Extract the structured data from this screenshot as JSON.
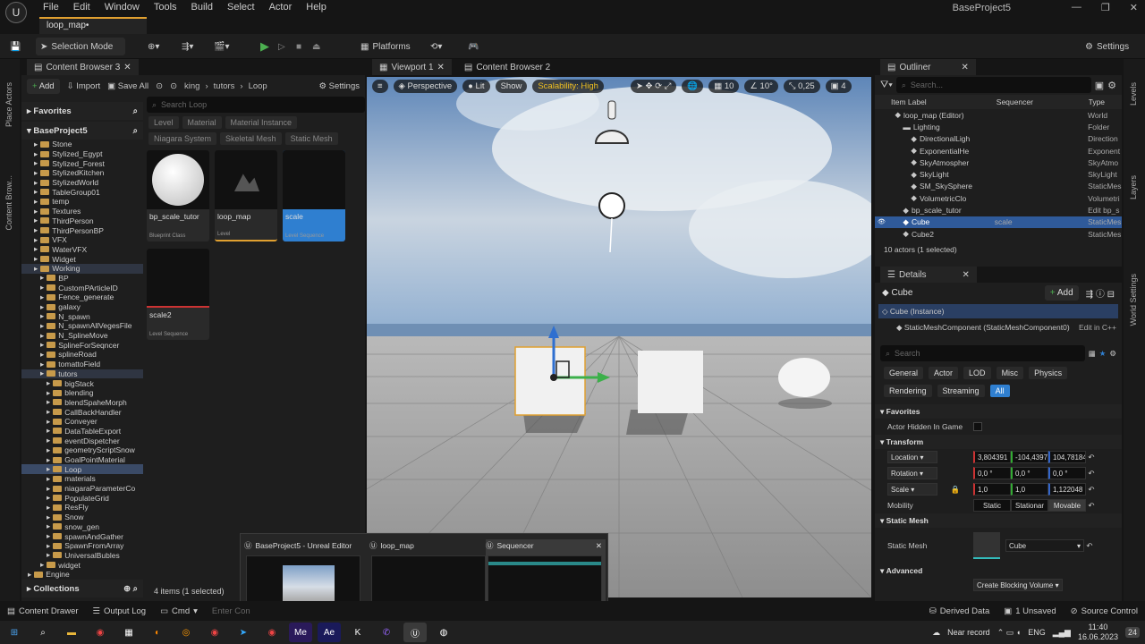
{
  "menu": {
    "items": [
      "File",
      "Edit",
      "Window",
      "Tools",
      "Build",
      "Select",
      "Actor",
      "Help"
    ],
    "project": "BaseProject5",
    "map_tab": "loop_map•"
  },
  "toolbar": {
    "selection_mode": "Selection Mode",
    "platforms": "Platforms",
    "settings": "Settings"
  },
  "left_strip": {
    "place_actors": "Place Actors",
    "content_browser": "Content Brow..."
  },
  "cb": {
    "tab": "Content Browser 3",
    "add": "Add",
    "import": "Import",
    "save_all": "Save All",
    "crumbs": [
      "king",
      "tutors",
      "Loop"
    ],
    "settings": "Settings",
    "favorites": "Favorites",
    "project": "BaseProject5",
    "collections": "Collections",
    "search_placeholder": "Search Loop",
    "filters": [
      "Level",
      "Material",
      "Material Instance",
      "Niagara System",
      "Skeletal Mesh",
      "Static Mesh"
    ],
    "tree": [
      {
        "label": "Stone",
        "indent": 2
      },
      {
        "label": "Stylized_Egypt",
        "indent": 2
      },
      {
        "label": "Stylized_Forest",
        "indent": 2
      },
      {
        "label": "StylizedKitchen",
        "indent": 2
      },
      {
        "label": "StylizedWorld",
        "indent": 2
      },
      {
        "label": "TableGroup01",
        "indent": 2
      },
      {
        "label": "temp",
        "indent": 2
      },
      {
        "label": "Textures",
        "indent": 2
      },
      {
        "label": "ThirdPerson",
        "indent": 2
      },
      {
        "label": "ThirdPersonBP",
        "indent": 2
      },
      {
        "label": "VFX",
        "indent": 2
      },
      {
        "label": "WaterVFX",
        "indent": 2
      },
      {
        "label": "Widget",
        "indent": 2
      },
      {
        "label": "Working",
        "indent": 2,
        "selected": "dim"
      },
      {
        "label": "BP",
        "indent": 3
      },
      {
        "label": "CustomPArticleID",
        "indent": 3
      },
      {
        "label": "Fence_generate",
        "indent": 3
      },
      {
        "label": "galaxy",
        "indent": 3
      },
      {
        "label": "N_spawn",
        "indent": 3
      },
      {
        "label": "N_spawnAllVegesFile",
        "indent": 3
      },
      {
        "label": "N_SplineMove",
        "indent": 3
      },
      {
        "label": "SplineForSeqncer",
        "indent": 3
      },
      {
        "label": "splineRoad",
        "indent": 3
      },
      {
        "label": "tomattoField",
        "indent": 3
      },
      {
        "label": "tutors",
        "indent": 3,
        "selected": "dim"
      },
      {
        "label": "bigStack",
        "indent": 4
      },
      {
        "label": "blending",
        "indent": 4
      },
      {
        "label": "blendSpaheMorph",
        "indent": 4
      },
      {
        "label": "CallBackHandler",
        "indent": 4
      },
      {
        "label": "Conveyer",
        "indent": 4
      },
      {
        "label": "DataTableExport",
        "indent": 4
      },
      {
        "label": "eventDispetcher",
        "indent": 4
      },
      {
        "label": "geometryScriptSnow",
        "indent": 4
      },
      {
        "label": "GoalPointMaterial",
        "indent": 4
      },
      {
        "label": "Loop",
        "indent": 4,
        "selected": "yes"
      },
      {
        "label": "materials",
        "indent": 4
      },
      {
        "label": "niagaraParameterCo",
        "indent": 4
      },
      {
        "label": "PopulateGrid",
        "indent": 4
      },
      {
        "label": "ResFly",
        "indent": 4
      },
      {
        "label": "Snow",
        "indent": 4
      },
      {
        "label": "snow_gen",
        "indent": 4
      },
      {
        "label": "spawnAndGather",
        "indent": 4
      },
      {
        "label": "SpawnFromArray",
        "indent": 4
      },
      {
        "label": "UniversalBubles",
        "indent": 4
      },
      {
        "label": "widget",
        "indent": 3
      },
      {
        "label": "Engine",
        "indent": 1
      }
    ],
    "assets": [
      {
        "name": "bp_scale_tutor",
        "type": "Blueprint Class"
      },
      {
        "name": "loop_map",
        "type": "Level"
      },
      {
        "name": "scale",
        "type": "Level Sequence"
      },
      {
        "name": "scale2",
        "type": "Level Sequence"
      }
    ],
    "footer": "4 items (1 selected)"
  },
  "viewport": {
    "tab1": "Viewport 1",
    "tab2": "Content Browser 2",
    "perspective": "Perspective",
    "lit": "Lit",
    "show": "Show",
    "scalability": "Scalability: High",
    "grid": "10",
    "angle": "10°",
    "scale": "0,25",
    "speed": "4"
  },
  "outliner": {
    "tab": "Outliner",
    "search": "Search...",
    "col_label": "Item Label",
    "col_seq": "Sequencer",
    "col_type": "Type",
    "rows": [
      {
        "label": "loop_map (Editor)",
        "seq": "",
        "type": "World",
        "indent": 1
      },
      {
        "label": "Lighting",
        "seq": "",
        "type": "Folder",
        "indent": 2
      },
      {
        "label": "DirectionalLigh",
        "seq": "",
        "type": "Direction",
        "indent": 3
      },
      {
        "label": "ExponentialHe",
        "seq": "",
        "type": "Exponent",
        "indent": 3
      },
      {
        "label": "SkyAtmospher",
        "seq": "",
        "type": "SkyAtmo",
        "indent": 3
      },
      {
        "label": "SkyLight",
        "seq": "",
        "type": "SkyLight",
        "indent": 3
      },
      {
        "label": "SM_SkySphere",
        "seq": "",
        "type": "StaticMes",
        "indent": 3
      },
      {
        "label": "VolumetricClo",
        "seq": "",
        "type": "Volumetri",
        "indent": 3
      },
      {
        "label": "bp_scale_tutor",
        "seq": "",
        "type": "Edit bp_s",
        "indent": 2
      },
      {
        "label": "Cube",
        "seq": "scale",
        "type": "StaticMes",
        "indent": 2,
        "selected": true
      },
      {
        "label": "Cube2",
        "seq": "",
        "type": "StaticMes",
        "indent": 2
      }
    ],
    "footer": "10 actors (1 selected)"
  },
  "details": {
    "tab": "Details",
    "name": "Cube",
    "add": "Add",
    "instance": "Cube (Instance)",
    "component": "StaticMeshComponent (StaticMeshComponent0)",
    "edit_cpp": "Edit in C++",
    "search": "Search",
    "filters": [
      "General",
      "Actor",
      "LOD",
      "Misc",
      "Physics",
      "Rendering",
      "Streaming",
      "All"
    ],
    "favorites": "Favorites",
    "actor_hidden": "Actor Hidden In Game",
    "transform": "Transform",
    "location": {
      "label": "Location",
      "x": "3,804391",
      "y": "-104,4397",
      "z": "104,78184"
    },
    "rotation": {
      "label": "Rotation",
      "x": "0,0 °",
      "y": "0,0 °",
      "z": "0,0 °"
    },
    "scale": {
      "label": "Scale",
      "x": "1,0",
      "y": "1,0",
      "z": "1,122048"
    },
    "mobility": {
      "label": "Mobility",
      "options": [
        "Static",
        "Stationar",
        "Movable"
      ]
    },
    "static_mesh_sec": "Static Mesh",
    "static_mesh_label": "Static Mesh",
    "mesh_value": "Cube",
    "advanced": "Advanced",
    "blocking": "Create Blocking Volume"
  },
  "right_strip": {
    "levels": "Levels",
    "layers": "Layers",
    "world": "World Settings"
  },
  "switcher": [
    {
      "title": "BaseProject5 - Unreal Editor"
    },
    {
      "title": "loop_map"
    },
    {
      "title": "Sequencer"
    }
  ],
  "status": {
    "content_drawer": "Content Drawer",
    "output_log": "Output Log",
    "cmd": "Cmd",
    "console": "Enter Con",
    "derived": "Derived Data",
    "unsaved": "1 Unsaved",
    "source": "Source Control"
  },
  "taskbar": {
    "record": "Near record",
    "lang": "ENG",
    "time": "11:40",
    "date": "16.06.2023",
    "badge": "24"
  },
  "colors": {
    "accent": "#2f7fd0",
    "selection": "#e0a030"
  }
}
